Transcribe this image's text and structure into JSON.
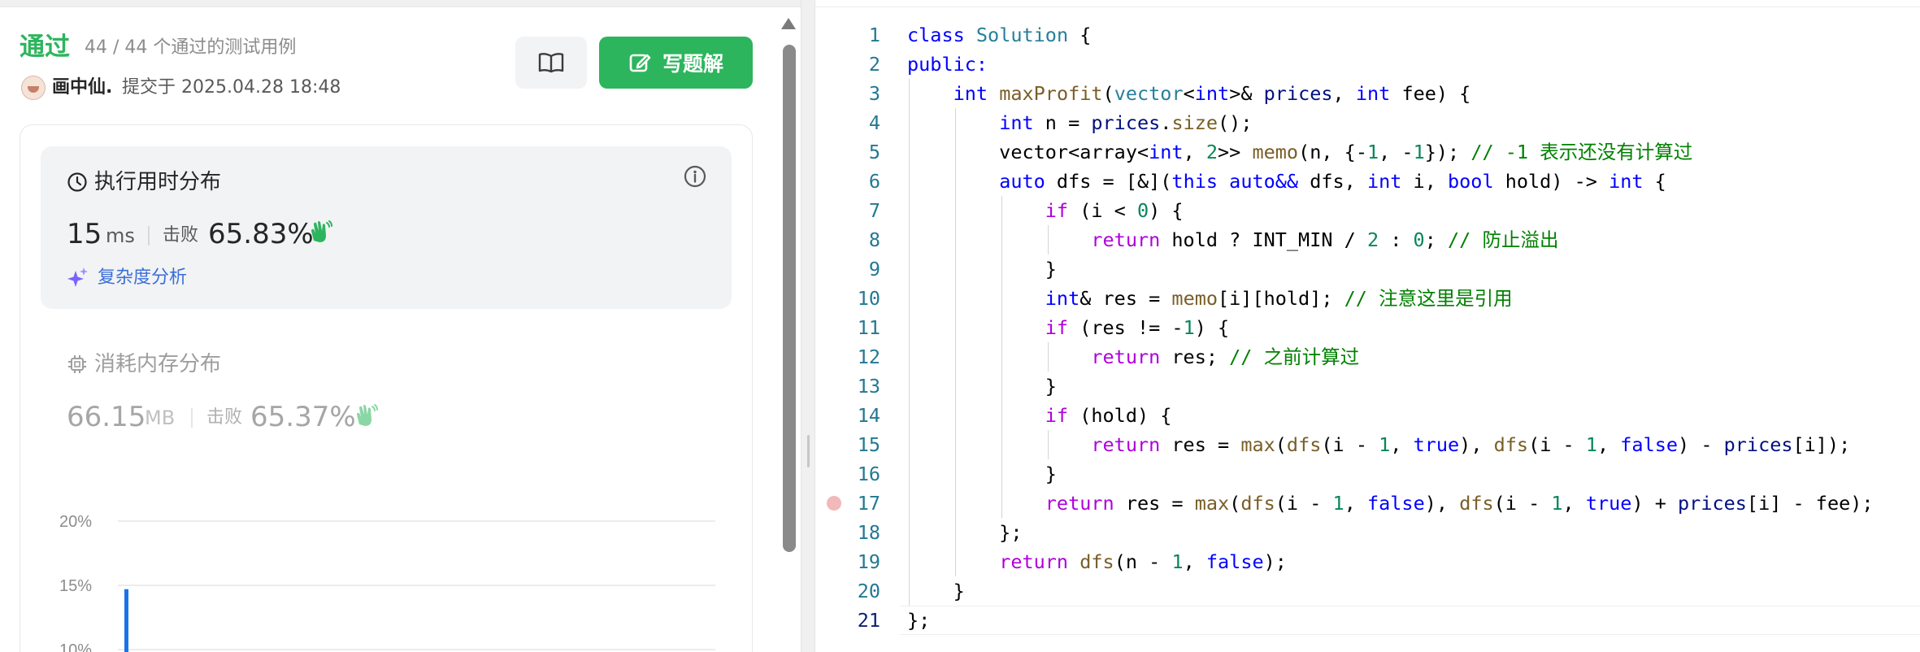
{
  "submission": {
    "status": "通过",
    "pass_count": "44 / 44 个通过的测试用例",
    "user": "画中仙.",
    "submitted_at": "提交于 2025.04.28 18:48",
    "write_solution_label": "写题解",
    "accent_color": "#2db55d"
  },
  "runtime": {
    "title": "执行用时分布",
    "value": "15",
    "unit": "ms",
    "beats_label": "击败",
    "beats_value": "65.83%",
    "complexity_link": "复杂度分析"
  },
  "memory": {
    "title": "消耗内存分布",
    "value": "66.15",
    "unit": "MB",
    "beats_label": "击败",
    "beats_value": "65.37%"
  },
  "chart_data": {
    "type": "bar",
    "y_ticks": [
      "20%",
      "15%",
      "10%"
    ],
    "ylim": [
      10,
      20
    ],
    "visible_bar_value": 14.7,
    "bar_color": "#1a73e8"
  },
  "code": {
    "language": "cpp",
    "active_line": 21,
    "breakpoint_line": 17,
    "lines": [
      [
        [
          "k",
          "class"
        ],
        [
          "p",
          " "
        ],
        [
          "t",
          "Solution"
        ],
        [
          "p",
          " {"
        ]
      ],
      [
        [
          "k",
          "public:"
        ]
      ],
      [
        [
          "p",
          "    "
        ],
        [
          "k",
          "int"
        ],
        [
          "p",
          " "
        ],
        [
          "f",
          "maxProfit"
        ],
        [
          "p",
          "("
        ],
        [
          "t",
          "vector"
        ],
        [
          "p",
          "<"
        ],
        [
          "k",
          "int"
        ],
        [
          "p",
          ">& "
        ],
        [
          "v",
          "prices"
        ],
        [
          "p",
          ", "
        ],
        [
          "k",
          "int"
        ],
        [
          "p",
          " fee) {"
        ]
      ],
      [
        [
          "p",
          "        "
        ],
        [
          "k",
          "int"
        ],
        [
          "p",
          " n = "
        ],
        [
          "v",
          "prices"
        ],
        [
          "p",
          "."
        ],
        [
          "f",
          "size"
        ],
        [
          "p",
          "();"
        ]
      ],
      [
        [
          "p",
          "        vector<array<"
        ],
        [
          "k",
          "int"
        ],
        [
          "p",
          ", "
        ],
        [
          "n",
          "2"
        ],
        [
          "p",
          ">> "
        ],
        [
          "f",
          "memo"
        ],
        [
          "p",
          "(n, {-"
        ],
        [
          "n",
          "1"
        ],
        [
          "p",
          ", -"
        ],
        [
          "n",
          "1"
        ],
        [
          "p",
          "}); "
        ],
        [
          "c",
          "// -1 表示还没有计算过"
        ]
      ],
      [
        [
          "p",
          "        "
        ],
        [
          "k",
          "auto"
        ],
        [
          "p",
          " dfs = [&]("
        ],
        [
          "k",
          "this"
        ],
        [
          "p",
          " "
        ],
        [
          "k",
          "auto&&"
        ],
        [
          "p",
          " dfs, "
        ],
        [
          "k",
          "int"
        ],
        [
          "p",
          " i, "
        ],
        [
          "k",
          "bool"
        ],
        [
          "p",
          " hold) -> "
        ],
        [
          "k",
          "int"
        ],
        [
          "p",
          " {"
        ]
      ],
      [
        [
          "p",
          "            "
        ],
        [
          "cf",
          "if"
        ],
        [
          "p",
          " (i < "
        ],
        [
          "n",
          "0"
        ],
        [
          "p",
          ") {"
        ]
      ],
      [
        [
          "p",
          "                "
        ],
        [
          "cf",
          "return"
        ],
        [
          "p",
          " hold ? INT_MIN / "
        ],
        [
          "n",
          "2"
        ],
        [
          "p",
          " : "
        ],
        [
          "n",
          "0"
        ],
        [
          "p",
          "; "
        ],
        [
          "c",
          "// 防止溢出"
        ]
      ],
      [
        [
          "p",
          "            }"
        ]
      ],
      [
        [
          "p",
          "            "
        ],
        [
          "k",
          "int"
        ],
        [
          "p",
          "& res = "
        ],
        [
          "f",
          "memo"
        ],
        [
          "p",
          "[i][hold]; "
        ],
        [
          "c",
          "// 注意这里是引用"
        ]
      ],
      [
        [
          "p",
          "            "
        ],
        [
          "cf",
          "if"
        ],
        [
          "p",
          " (res != -"
        ],
        [
          "n",
          "1"
        ],
        [
          "p",
          ") {"
        ]
      ],
      [
        [
          "p",
          "                "
        ],
        [
          "cf",
          "return"
        ],
        [
          "p",
          " res; "
        ],
        [
          "c",
          "// 之前计算过"
        ]
      ],
      [
        [
          "p",
          "            }"
        ]
      ],
      [
        [
          "p",
          "            "
        ],
        [
          "cf",
          "if"
        ],
        [
          "p",
          " (hold) {"
        ]
      ],
      [
        [
          "p",
          "                "
        ],
        [
          "cf",
          "return"
        ],
        [
          "p",
          " res = "
        ],
        [
          "f",
          "max"
        ],
        [
          "p",
          "("
        ],
        [
          "f",
          "dfs"
        ],
        [
          "p",
          "(i - "
        ],
        [
          "n",
          "1"
        ],
        [
          "p",
          ", "
        ],
        [
          "k",
          "true"
        ],
        [
          "p",
          "), "
        ],
        [
          "f",
          "dfs"
        ],
        [
          "p",
          "(i - "
        ],
        [
          "n",
          "1"
        ],
        [
          "p",
          ", "
        ],
        [
          "k",
          "false"
        ],
        [
          "p",
          ") - "
        ],
        [
          "v",
          "prices"
        ],
        [
          "p",
          "[i]);"
        ]
      ],
      [
        [
          "p",
          "            }"
        ]
      ],
      [
        [
          "p",
          "            "
        ],
        [
          "cf",
          "return"
        ],
        [
          "p",
          " res = "
        ],
        [
          "f",
          "max"
        ],
        [
          "p",
          "("
        ],
        [
          "f",
          "dfs"
        ],
        [
          "p",
          "(i - "
        ],
        [
          "n",
          "1"
        ],
        [
          "p",
          ", "
        ],
        [
          "k",
          "false"
        ],
        [
          "p",
          "), "
        ],
        [
          "f",
          "dfs"
        ],
        [
          "p",
          "(i - "
        ],
        [
          "n",
          "1"
        ],
        [
          "p",
          ", "
        ],
        [
          "k",
          "true"
        ],
        [
          "p",
          ") + "
        ],
        [
          "v",
          "prices"
        ],
        [
          "p",
          "[i] - fee);"
        ]
      ],
      [
        [
          "p",
          "        };"
        ]
      ],
      [
        [
          "p",
          "        "
        ],
        [
          "cf",
          "return"
        ],
        [
          "p",
          " "
        ],
        [
          "f",
          "dfs"
        ],
        [
          "p",
          "(n - "
        ],
        [
          "n",
          "1"
        ],
        [
          "p",
          ", "
        ],
        [
          "k",
          "false"
        ],
        [
          "p",
          ");"
        ]
      ],
      [
        [
          "p",
          "    }"
        ]
      ],
      [
        [
          "p",
          "};"
        ]
      ]
    ]
  }
}
